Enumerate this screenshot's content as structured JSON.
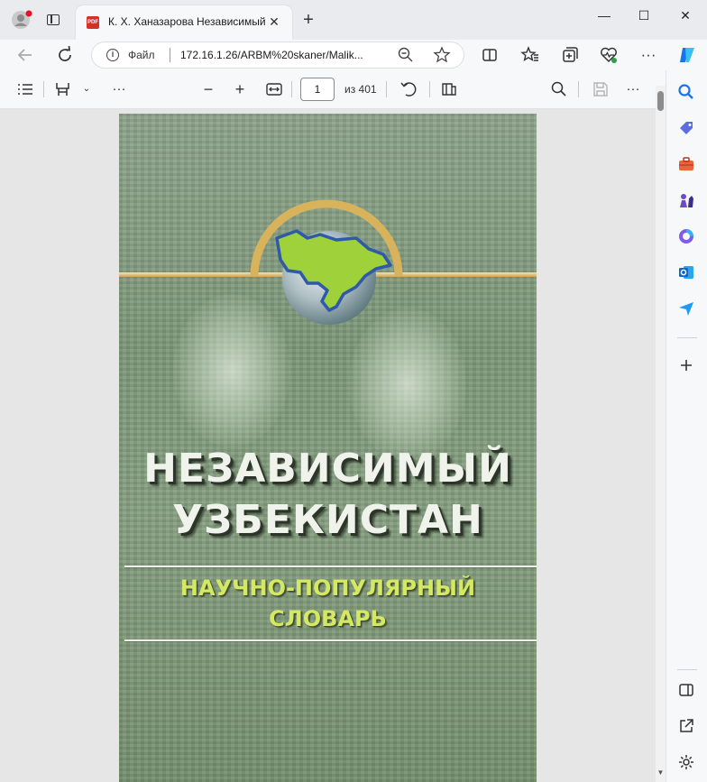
{
  "window": {
    "tab_title": "К. Х. Ханазарова Независимый",
    "pdf_badge": "PDF",
    "new_tab_symbol": "+",
    "close_tab_symbol": "✕",
    "minimize_symbol": "—",
    "maximize_symbol": "☐",
    "close_window_symbol": "✕"
  },
  "address_bar": {
    "site_label": "Файл",
    "url": "172.16.1.26/ARBM%20skaner/Malik..."
  },
  "pdf_toolbar": {
    "current_page": "1",
    "page_total": "из 401"
  },
  "document": {
    "cover_title_line1": "НЕЗАВИСИМЫЙ",
    "cover_title_line2": "УЗБЕКИСТАН",
    "cover_subtitle_line1": "НАУЧНО-ПОПУЛЯРНЫЙ",
    "cover_subtitle_line2": "СЛОВАРЬ"
  },
  "colors": {
    "cover_green": "#7d9879",
    "subtitle_yellow": "#d5e864",
    "map_green": "#9fd13a",
    "map_border_blue": "#2f5aa8",
    "edge_blue": "#1a73e8"
  },
  "icons": {
    "profile": "profile-avatar-icon",
    "tab_actions": "tab-actions-icon",
    "back": "back-arrow-icon",
    "refresh": "refresh-icon",
    "zoom": "zoom-out-icon",
    "favorite": "star-icon",
    "split_screen": "split-screen-icon",
    "favorites": "favorites-icon",
    "collections": "collections-icon",
    "browser_essentials": "heart-pulse-icon",
    "more": "more-dots-icon",
    "copilot": "copilot-icon",
    "contents": "contents-list-icon",
    "draw": "draw-icon",
    "rotate": "rotate-icon",
    "page_view": "page-view-icon",
    "search": "search-icon",
    "save": "save-icon"
  }
}
